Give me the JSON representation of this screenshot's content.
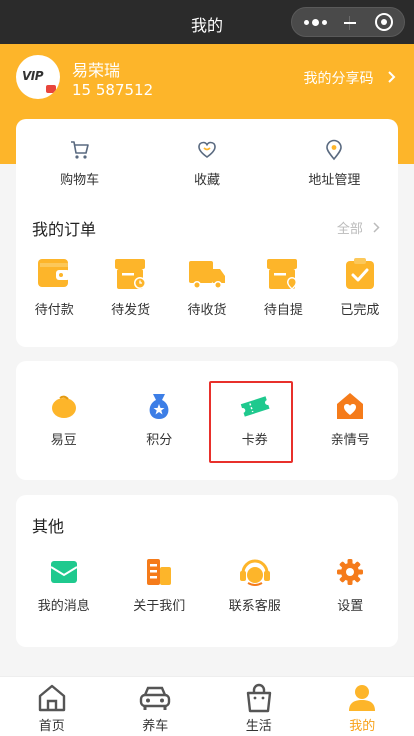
{
  "titlebar": {
    "title": "我的"
  },
  "profile": {
    "name": "易荣瑞",
    "phone": "15     587512",
    "share_label": "我的分享码",
    "avatar_text": "VIP"
  },
  "quick": [
    {
      "label": "购物车",
      "icon": "cart-icon"
    },
    {
      "label": "收藏",
      "icon": "heart-icon"
    },
    {
      "label": "地址管理",
      "icon": "location-icon"
    }
  ],
  "orders": {
    "title": "我的订单",
    "all_label": "全部",
    "items": [
      {
        "label": "待付款",
        "icon": "wallet-icon"
      },
      {
        "label": "待发货",
        "icon": "box-clock-icon"
      },
      {
        "label": "待收货",
        "icon": "truck-icon"
      },
      {
        "label": "待自提",
        "icon": "pickup-icon"
      },
      {
        "label": "已完成",
        "icon": "clipboard-check-icon"
      }
    ]
  },
  "assets": [
    {
      "label": "易豆",
      "icon": "bean-icon"
    },
    {
      "label": "积分",
      "icon": "points-bag-icon"
    },
    {
      "label": "卡券",
      "icon": "ticket-icon"
    },
    {
      "label": "亲情号",
      "icon": "family-home-icon"
    }
  ],
  "other": {
    "title": "其他",
    "items": [
      {
        "label": "我的消息",
        "icon": "message-icon"
      },
      {
        "label": "关于我们",
        "icon": "building-icon"
      },
      {
        "label": "联系客服",
        "icon": "headset-icon"
      },
      {
        "label": "设置",
        "icon": "gear-icon"
      }
    ]
  },
  "tabbar": [
    {
      "label": "首页",
      "icon": "home-icon",
      "active": false
    },
    {
      "label": "养车",
      "icon": "car-icon",
      "active": false
    },
    {
      "label": "生活",
      "icon": "bag-icon",
      "active": false
    },
    {
      "label": "我的",
      "icon": "user-icon",
      "active": true
    }
  ],
  "colors": {
    "brand": "#fdb52a",
    "active_tab": "#f7a21a",
    "highlight_border": "#e8302b"
  }
}
